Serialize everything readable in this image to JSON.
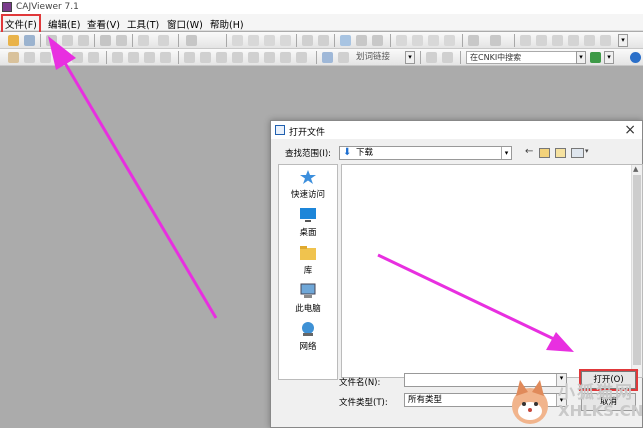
{
  "app": {
    "title": "CAJViewer 7.1"
  },
  "menubar": {
    "items": [
      "文件(F)",
      "编辑(E)",
      "查看(V)",
      "工具(T)",
      "窗口(W)",
      "帮助(H)"
    ]
  },
  "toolbar": {
    "link_label": "划词链接",
    "search_placeholder": "在CNKI中搜索"
  },
  "dialog": {
    "title": "打开文件",
    "look_in_label": "查找范围(I):",
    "look_in_value": "下载",
    "places": [
      "快速访问",
      "桌面",
      "库",
      "此电脑",
      "网络"
    ],
    "filename_label": "文件名(N):",
    "filename_value": "",
    "filetype_label": "文件类型(T):",
    "filetype_value": "所有类型",
    "open_button": "打开(O)",
    "cancel_button": "取消"
  },
  "watermark": {
    "line1": "小狐猫网",
    "line2": "XHLKS.CN"
  },
  "colors": {
    "annotation_arrow": "#e82fe0",
    "highlight_box": "#e0383a",
    "workspace_bg": "#ababab"
  }
}
